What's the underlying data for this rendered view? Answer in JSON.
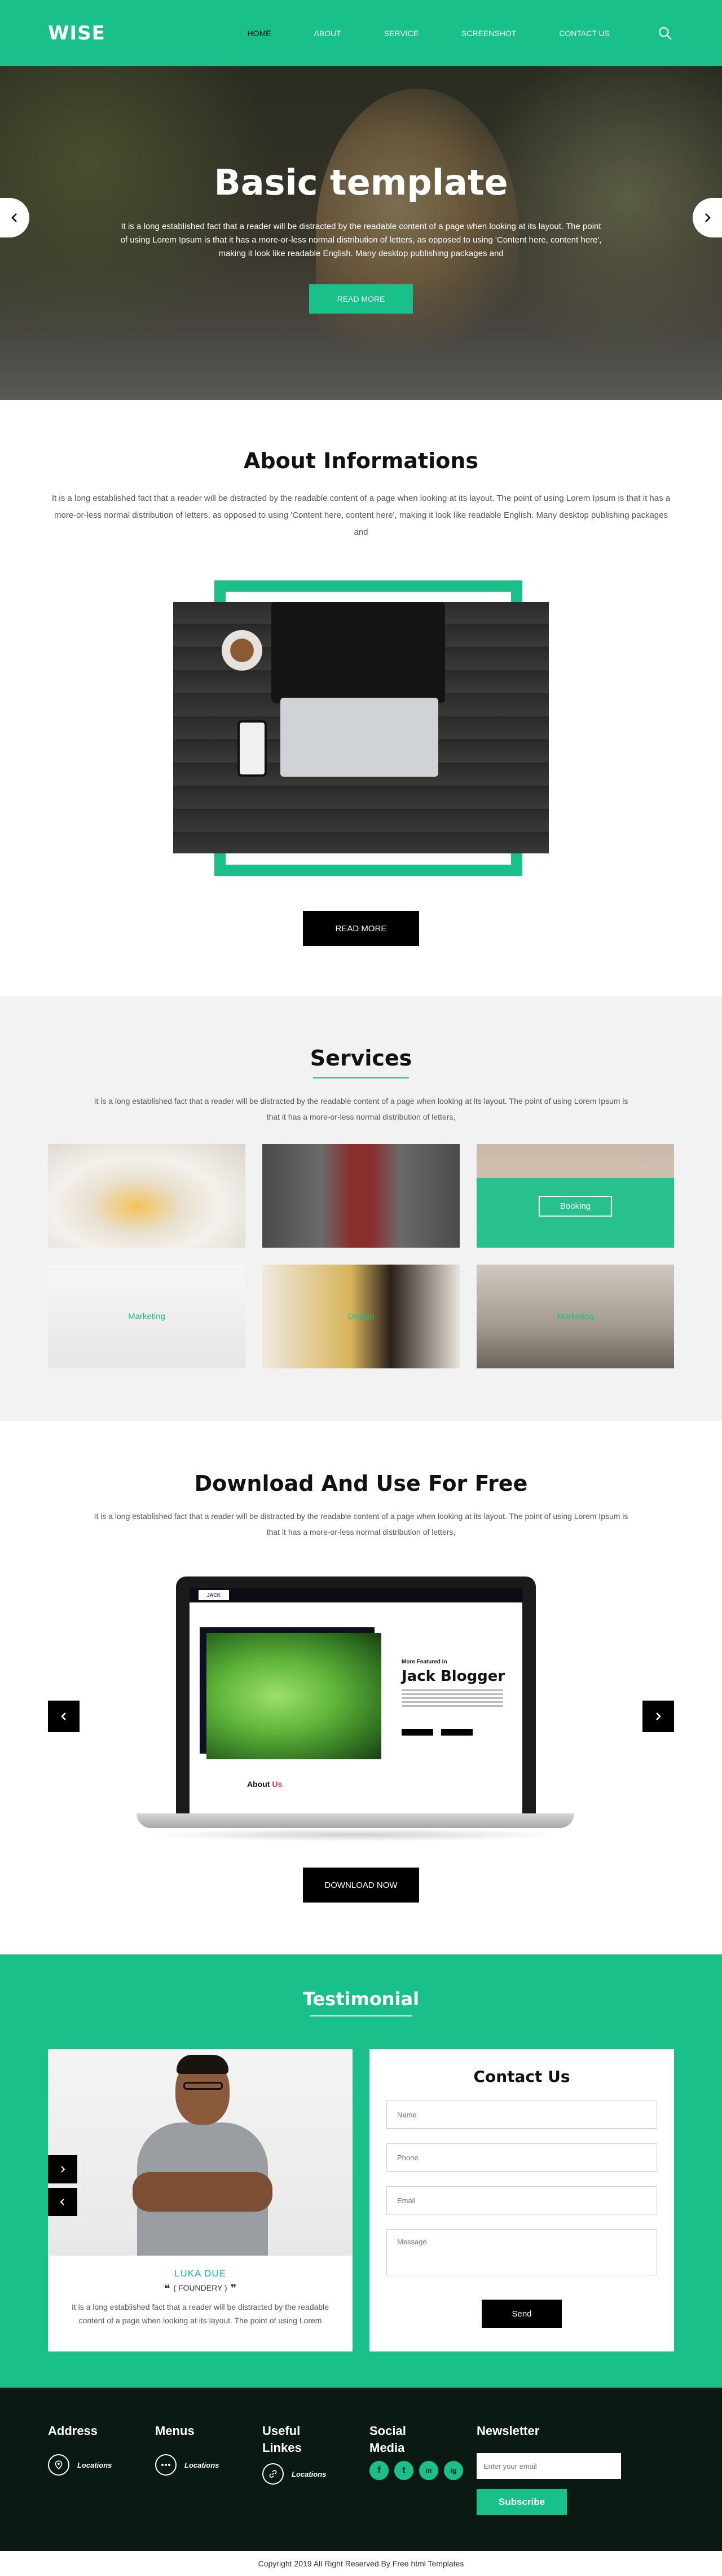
{
  "header": {
    "logo": "WISE",
    "nav": [
      "HOME",
      "ABOUT",
      "SERVICE",
      "SCREENSHOT",
      "CONTACT US"
    ]
  },
  "hero": {
    "title": "Basic template",
    "text": "It is a long established fact that a reader will be distracted by the readable content of a page when looking at its layout. The point of using Lorem Ipsum is that it has a more-or-less normal distribution of letters, as opposed to using 'Content here, content here', making it look like readable English. Many desktop publishing packages and",
    "button": "READ MORE"
  },
  "about": {
    "title": "About Informations",
    "text": "It is a long established fact that a reader will be distracted by the readable content of a page when looking at its layout. The point of using Lorem Ipsum is that it has a more-or-less normal distribution of letters, as opposed to using 'Content here, content here', making it look like readable English. Many desktop publishing packages and",
    "button": "READ MORE"
  },
  "services": {
    "title": "Services",
    "text": "It is a long established fact that a reader will be distracted by the readable content of a page when looking at its layout. The point of using Lorem Ipsum is that it has a more-or-less normal distribution of letters,",
    "items": [
      "Booking",
      "Marketing",
      "Design",
      "Marketing"
    ]
  },
  "download": {
    "title": "Download And Use For Free",
    "text": "It is a long established fact that a reader will be distracted by the readable content of a page when looking at its layout. The point of using Lorem Ipsum is that it has a more-or-less normal distribution of letters,",
    "mock": {
      "logo": "JACK",
      "featured": "More Featured in",
      "blogger": "Jack Blogger",
      "about_a": "About",
      "about_b": "Us"
    },
    "button": "DOWNLOAD NOW"
  },
  "testimonial": {
    "title": "Testimonial",
    "name": "LUKA DUE",
    "role": "( FOUNDERY )",
    "text": "It is a long established fact that a reader will be distracted by the readable content of a page when looking at its layout. The point of using Lorem"
  },
  "contact": {
    "title": "Contact Us",
    "name_placeholder": "Name",
    "phone_placeholder": "Phone",
    "email_placeholder": "Email",
    "message_placeholder": "Message",
    "send": "Send"
  },
  "footer": {
    "address": "Address",
    "menus": "Menus",
    "useful_line1": "Useful",
    "useful_line2": "Linkes",
    "social_line1": "Social",
    "social_line2": "Media",
    "newsletter": "Newsletter",
    "locations": "Locations",
    "email_placeholder": "Enter your email",
    "subscribe": "Subscribe",
    "social_icons": [
      "f",
      "t",
      "in",
      "ig"
    ]
  },
  "copyright": "Copyright 2019 All Right Reserved By Free html Templates",
  "colors": {
    "accent": "#19c08a",
    "dark": "#0a1a13"
  }
}
